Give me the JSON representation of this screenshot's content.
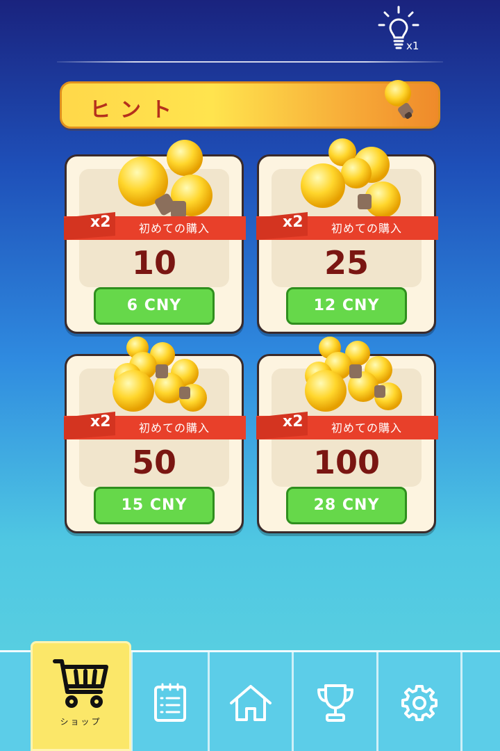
{
  "header": {
    "hint_count": "x1"
  },
  "banner": {
    "title": "ヒント"
  },
  "packs": [
    {
      "badge": "x2",
      "ribbon": "初めての購入",
      "amount": "10",
      "price": "6 CNY"
    },
    {
      "badge": "x2",
      "ribbon": "初めての購入",
      "amount": "25",
      "price": "12 CNY"
    },
    {
      "badge": "x2",
      "ribbon": "初めての購入",
      "amount": "50",
      "price": "15 CNY"
    },
    {
      "badge": "x2",
      "ribbon": "初めての購入",
      "amount": "100",
      "price": "28 CNY"
    }
  ],
  "nav": {
    "shop_label": "ショップ",
    "items": [
      "shop-icon",
      "list-icon",
      "home-icon",
      "trophy-icon",
      "gear-icon"
    ]
  },
  "colors": {
    "price_button": "#66d84a",
    "amount": "#7a1612",
    "ribbon": "#e8402a",
    "active_tab": "#fbe769"
  }
}
